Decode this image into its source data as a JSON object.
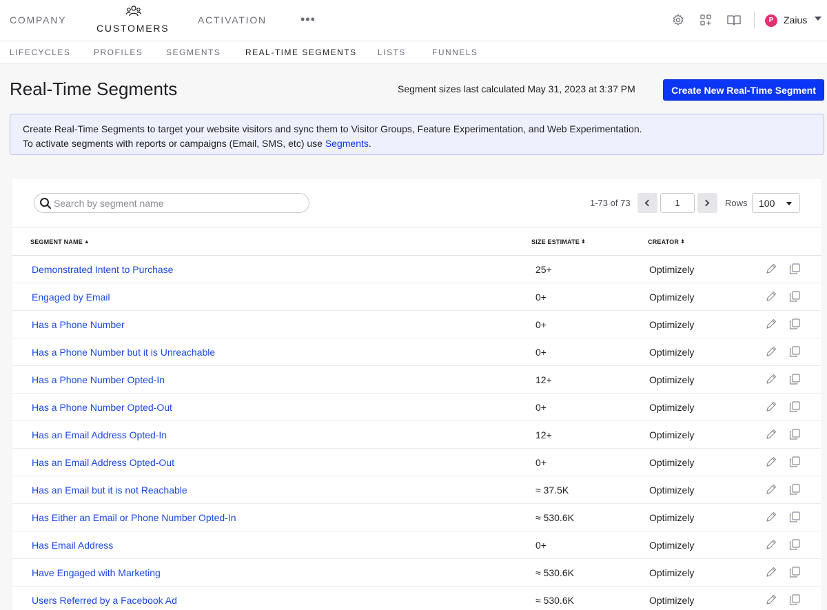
{
  "topnav": {
    "company": "COMPANY",
    "customers": "CUSTOMERS",
    "activation": "ACTIVATION",
    "more": "•••",
    "user_initial": "P",
    "user_name": "Zaius"
  },
  "subnav": [
    "LIFECYCLES",
    "PROFILES",
    "SEGMENTS",
    "REAL-TIME SEGMENTS",
    "LISTS",
    "FUNNELS"
  ],
  "header": {
    "title": "Real-Time Segments",
    "calc_note": "Segment sizes last calculated May 31, 2023 at 3:37 PM",
    "create_button": "Create New Real-Time Segment"
  },
  "banner": {
    "line1": "Create Real-Time Segments to target your website visitors and sync them to Visitor Groups, Feature Experimentation, and Web Experimentation.",
    "line2_prefix": "To activate segments with reports or campaigns (Email, SMS, etc) use ",
    "line2_link": "Segments",
    "line2_suffix": "."
  },
  "search": {
    "placeholder": "Search by segment name"
  },
  "pager": {
    "range": "1-73 of 73",
    "page": "1",
    "rows_label": "Rows",
    "rows_value": "100"
  },
  "columns": {
    "name": "SEGMENT NAME",
    "size": "SIZE ESTIMATE",
    "creator": "CREATOR"
  },
  "rows": [
    {
      "name": "Demonstrated Intent to Purchase",
      "size": "25+",
      "creator": "Optimizely"
    },
    {
      "name": "Engaged by Email",
      "size": "0+",
      "creator": "Optimizely"
    },
    {
      "name": "Has a Phone Number",
      "size": "0+",
      "creator": "Optimizely"
    },
    {
      "name": "Has a Phone Number but it is Unreachable",
      "size": "0+",
      "creator": "Optimizely"
    },
    {
      "name": "Has a Phone Number Opted-In",
      "size": "12+",
      "creator": "Optimizely"
    },
    {
      "name": "Has a Phone Number Opted-Out",
      "size": "0+",
      "creator": "Optimizely"
    },
    {
      "name": "Has an Email Address Opted-In",
      "size": "12+",
      "creator": "Optimizely"
    },
    {
      "name": "Has an Email Address Opted-Out",
      "size": "0+",
      "creator": "Optimizely"
    },
    {
      "name": "Has an Email but it is not Reachable",
      "size": "≈ 37.5K",
      "creator": "Optimizely"
    },
    {
      "name": "Has Either an Email or Phone Number Opted-In",
      "size": "≈ 530.6K",
      "creator": "Optimizely"
    },
    {
      "name": "Has Email Address",
      "size": "0+",
      "creator": "Optimizely"
    },
    {
      "name": "Have Engaged with Marketing",
      "size": "≈ 530.6K",
      "creator": "Optimizely"
    },
    {
      "name": "Users Referred by a Facebook Ad",
      "size": "≈ 530.6K",
      "creator": "Optimizely"
    }
  ],
  "colors": {
    "primary": "#0b36f5",
    "link": "#1a47e6",
    "avatar": "#e4316f",
    "banner_bg": "#eef0fe"
  }
}
